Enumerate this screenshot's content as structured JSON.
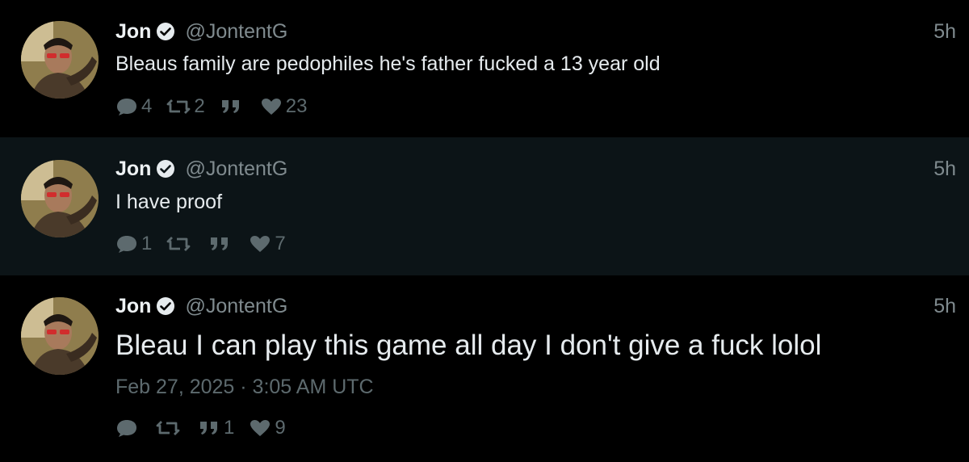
{
  "tweets": [
    {
      "name": "Jon",
      "handle": "@JontentG",
      "time": "5h",
      "text": "Bleaus family are pedophiles he's father fucked a 13 year old",
      "replies": "4",
      "retweets": "2",
      "quotes": "",
      "likes": "23"
    },
    {
      "name": "Jon",
      "handle": "@JontentG",
      "time": "5h",
      "text": "I have proof",
      "replies": "1",
      "retweets": "",
      "quotes": "",
      "likes": "7"
    },
    {
      "name": "Jon",
      "handle": "@JontentG",
      "time": "5h",
      "text": "Bleau I can play this game all day I don't give a fuck lolol",
      "date": "Feb 27, 2025 · 3:05 AM UTC",
      "replies": "",
      "retweets": "",
      "quotes": "1",
      "likes": "9"
    }
  ],
  "icons": {
    "verified": "verified-badge-icon",
    "reply": "comment-icon",
    "retweet": "retweet-icon",
    "quote": "quote-icon",
    "like": "heart-icon"
  },
  "colors": {
    "background": "#000000",
    "highlight_background": "#0c1417",
    "thread_line": "#5d7074",
    "muted_text": "#7f8a8e",
    "action_gray": "#5d6a6e"
  }
}
